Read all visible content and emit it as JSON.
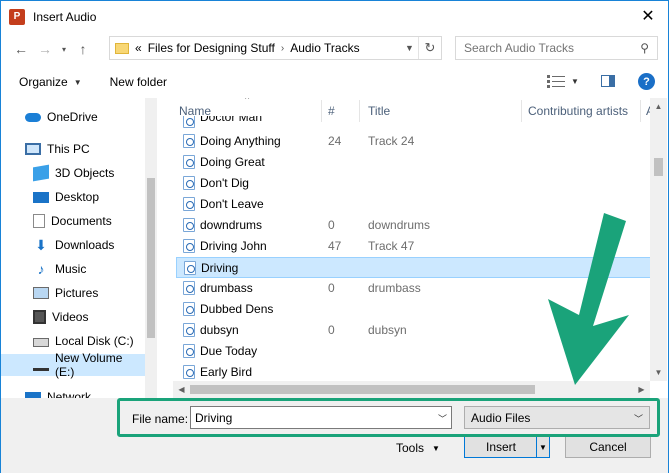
{
  "window": {
    "title": "Insert Audio",
    "app_icon_letter": "P"
  },
  "nav": {
    "breadcrumb": [
      "«",
      "Files for Designing Stuff",
      "Audio Tracks"
    ],
    "search_placeholder": "Search Audio Tracks"
  },
  "toolbar": {
    "organize_label": "Organize",
    "new_folder_label": "New folder",
    "help_label": "?"
  },
  "sidebar": {
    "items": [
      {
        "label": "OneDrive",
        "icon": "cloud-icon"
      },
      {
        "label": "This PC",
        "icon": "computer-icon"
      },
      {
        "label": "3D Objects",
        "icon": "cube-icon"
      },
      {
        "label": "Desktop",
        "icon": "desktop-icon"
      },
      {
        "label": "Documents",
        "icon": "document-icon"
      },
      {
        "label": "Downloads",
        "icon": "download-icon"
      },
      {
        "label": "Music",
        "icon": "music-icon"
      },
      {
        "label": "Pictures",
        "icon": "picture-icon"
      },
      {
        "label": "Videos",
        "icon": "video-icon"
      },
      {
        "label": "Local Disk (C:)",
        "icon": "drive-icon"
      },
      {
        "label": "New Volume (E:)",
        "icon": "drive-icon"
      },
      {
        "label": "Network",
        "icon": "network-icon"
      }
    ]
  },
  "columns": {
    "name": "Name",
    "num": "#",
    "title": "Title",
    "artists": "Contributing artists",
    "more": "A"
  },
  "files": [
    {
      "name": "Doctor Man",
      "num": "",
      "title": ""
    },
    {
      "name": "Doing Anything",
      "num": "24",
      "title": "Track 24"
    },
    {
      "name": "Doing Great",
      "num": "",
      "title": ""
    },
    {
      "name": "Don't Dig",
      "num": "",
      "title": ""
    },
    {
      "name": "Don't Leave",
      "num": "",
      "title": ""
    },
    {
      "name": "downdrums",
      "num": "0",
      "title": "downdrums"
    },
    {
      "name": "Driving John",
      "num": "47",
      "title": "Track 47"
    },
    {
      "name": "Driving",
      "num": "",
      "title": ""
    },
    {
      "name": "drumbass",
      "num": "0",
      "title": "drumbass"
    },
    {
      "name": "Dubbed Dens",
      "num": "",
      "title": ""
    },
    {
      "name": "dubsyn",
      "num": "0",
      "title": "dubsyn"
    },
    {
      "name": "Due Today",
      "num": "",
      "title": ""
    },
    {
      "name": "Early Bird",
      "num": "",
      "title": ""
    }
  ],
  "bottom": {
    "file_name_label": "File name:",
    "file_name_value": "Driving",
    "file_type": "Audio Files",
    "tools_label": "Tools",
    "insert_label": "Insert",
    "cancel_label": "Cancel"
  },
  "colors": {
    "selection": "#cce8ff",
    "annotation": "#1aa37a"
  }
}
